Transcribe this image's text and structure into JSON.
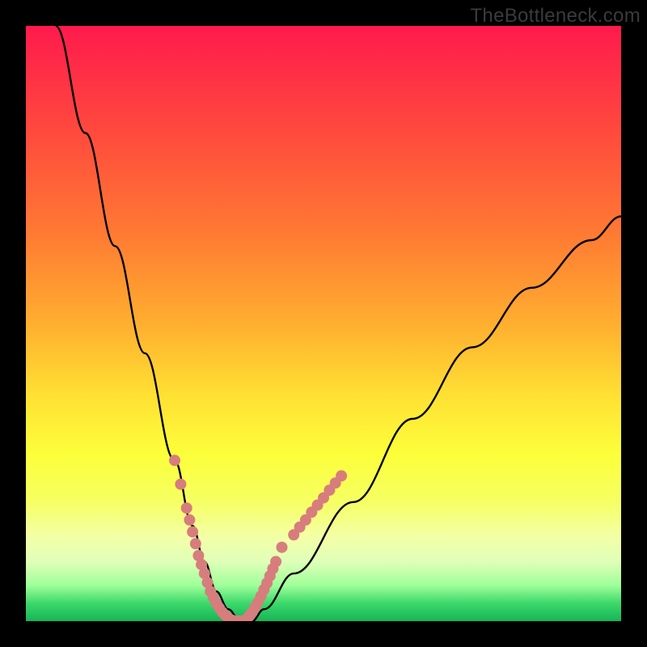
{
  "watermark": "TheBottleneck.com",
  "chart_data": {
    "type": "line",
    "title": "",
    "xlabel": "",
    "ylabel": "",
    "xlim": [
      0,
      100
    ],
    "ylim": [
      0,
      100
    ],
    "series": [
      {
        "name": "bottleneck-curve",
        "x": [
          5,
          10,
          15,
          20,
          25,
          28,
          30,
          32,
          34,
          36,
          38,
          40,
          45,
          55,
          65,
          75,
          85,
          95,
          100
        ],
        "y": [
          100,
          82,
          63,
          45,
          27,
          16,
          10,
          5,
          2,
          0,
          0,
          2,
          8,
          20,
          34,
          46,
          56,
          64,
          68
        ]
      }
    ],
    "markers": {
      "name": "highlight-dots",
      "color": "#d77d7d",
      "x": [
        25,
        26,
        27,
        27.5,
        28,
        28.5,
        29,
        29.5,
        30,
        30.5,
        31,
        31.5,
        32,
        32.5,
        33,
        33.5,
        34,
        34.5,
        35,
        35.5,
        36,
        36.5,
        37,
        37.5,
        38,
        38.5,
        39,
        39.5,
        40,
        40.5,
        41,
        41.5,
        42,
        43,
        45,
        46,
        47,
        48,
        49,
        50,
        51,
        52,
        53
      ],
      "y": [
        27,
        23,
        19,
        17,
        15,
        13,
        11,
        9.5,
        8,
        6.5,
        5,
        4,
        3,
        2.2,
        1.5,
        1,
        0.5,
        0.2,
        0,
        0,
        0,
        0,
        0.3,
        0.8,
        1.5,
        2.3,
        3.2,
        4.2,
        5.3,
        6.4,
        7.6,
        8.8,
        10,
        12.4,
        14.5,
        15.8,
        17,
        18.3,
        19.5,
        20.7,
        22,
        23.2,
        24.4
      ]
    }
  }
}
